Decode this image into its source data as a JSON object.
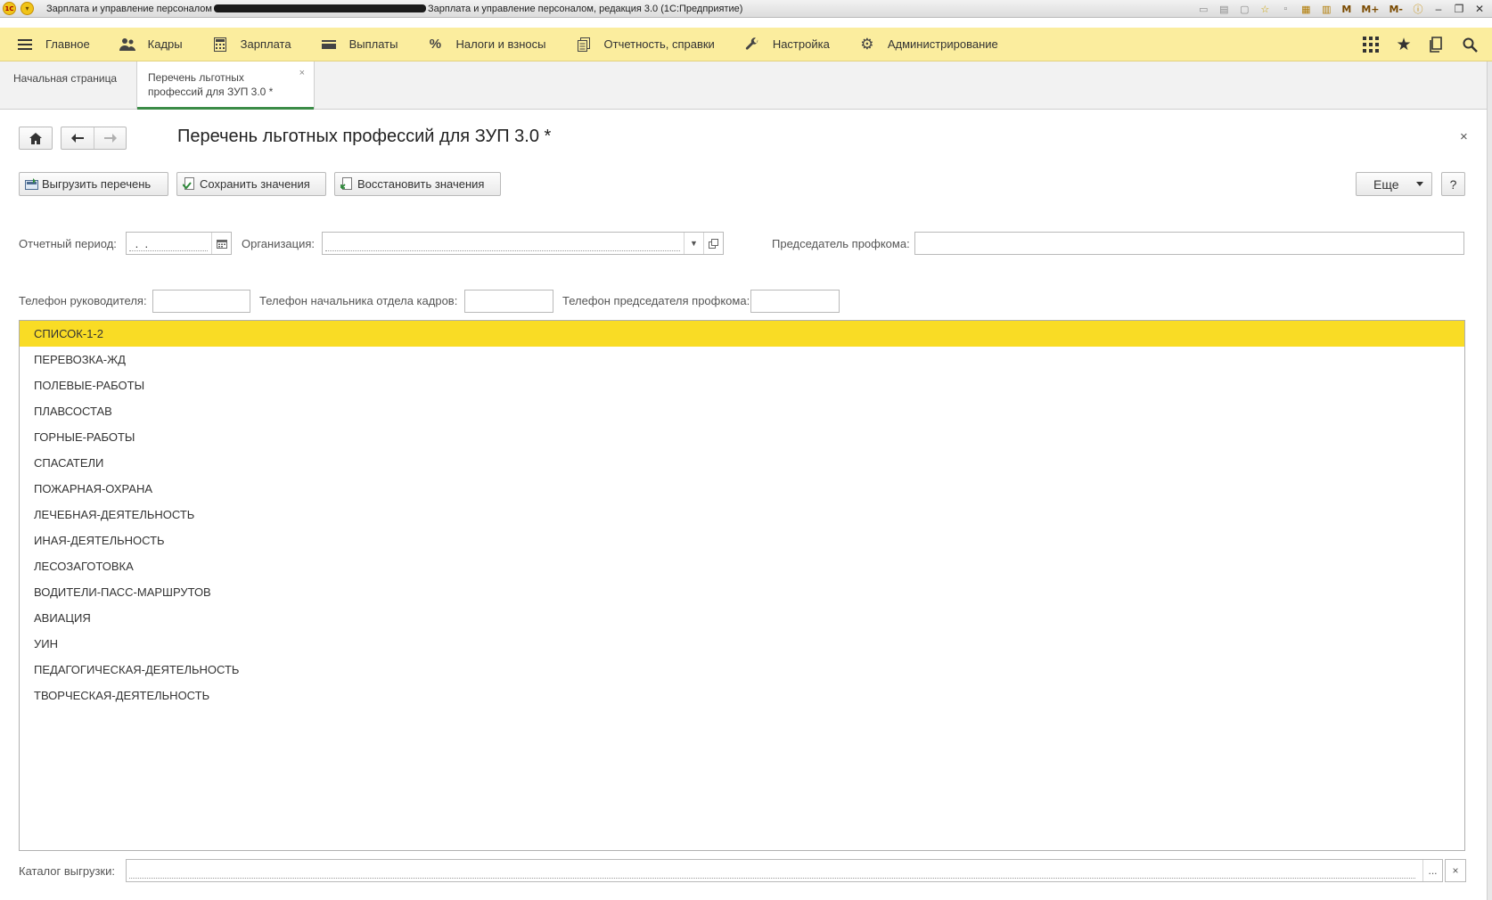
{
  "window": {
    "title_prefix": "Зарплата и управление персоналом",
    "title_suffix": "Зарплата и управление персоналом, редакция 3.0  (1С:Предприятие)",
    "logo_text": "1С",
    "tools_text": [
      "M",
      "M+",
      "M-"
    ]
  },
  "sections": {
    "items": [
      {
        "label": "Главное",
        "icon": "menu-icon"
      },
      {
        "label": "Кадры",
        "icon": "people-icon"
      },
      {
        "label": "Зарплата",
        "icon": "calculator-icon"
      },
      {
        "label": "Выплаты",
        "icon": "wallet-icon"
      },
      {
        "label": "Налоги и взносы",
        "icon": "percent-icon"
      },
      {
        "label": "Отчетность, справки",
        "icon": "documents-icon"
      },
      {
        "label": "Настройка",
        "icon": "wrench-icon"
      },
      {
        "label": "Администрирование",
        "icon": "gear-icon"
      }
    ],
    "right_icons": [
      "apps-grid-icon",
      "favorites-star-icon",
      "history-icon",
      "search-icon"
    ]
  },
  "tabs": {
    "home": "Начальная страница",
    "active_line1": "Перечень льготных",
    "active_line2": "профессий для ЗУП 3.0 *",
    "close_glyph": "×"
  },
  "form": {
    "title": "Перечень льготных профессий для ЗУП 3.0 *",
    "close_glyph": "×",
    "buttons": {
      "export": "Выгрузить перечень",
      "save": "Сохранить значения",
      "restore": "Восстановить значения",
      "more": "Еще",
      "help": "?"
    },
    "fields": {
      "period_label": "Отчетный период:",
      "period_value": " .  .",
      "organization_label": "Организация:",
      "organization_value": "",
      "chairman_label": "Председатель профкома:",
      "chairman_value": "",
      "head_phone_label": "Телефон руководителя:",
      "head_phone_value": "",
      "hr_phone_label": "Телефон начальника отдела кадров:",
      "hr_phone_value": "",
      "chairman_phone_label": "Телефон председателя профкома:",
      "chairman_phone_value": ""
    },
    "list": [
      "СПИСОК-1-2",
      "ПЕРЕВОЗКА-ЖД",
      "ПОЛЕВЫЕ-РАБОТЫ",
      "ПЛАВСОСТАВ",
      "ГОРНЫЕ-РАБОТЫ",
      "СПАСАТЕЛИ",
      "ПОЖАРНАЯ-ОХРАНА",
      "ЛЕЧЕБНАЯ-ДЕЯТЕЛЬНОСТЬ",
      "ИНАЯ-ДЕЯТЕЛЬНОСТЬ",
      "ЛЕСОЗАГОТОВКА",
      "ВОДИТЕЛИ-ПАСС-МАРШРУТОВ",
      "АВИАЦИЯ",
      "УИН",
      "ПЕДАГОГИЧЕСКАЯ-ДЕЯТЕЛЬНОСТЬ",
      "ТВОРЧЕСКАЯ-ДЕЯТЕЛЬНОСТЬ"
    ],
    "selected_index": 0,
    "catalog_label": "Каталог выгрузки:",
    "catalog_value": "",
    "catalog_select_glyph": "...",
    "catalog_clear_glyph": "×"
  },
  "colors": {
    "sections_bg": "#fbed9e",
    "selected_row": "#f9dc25",
    "active_tab_accent": "#3b8c47"
  }
}
